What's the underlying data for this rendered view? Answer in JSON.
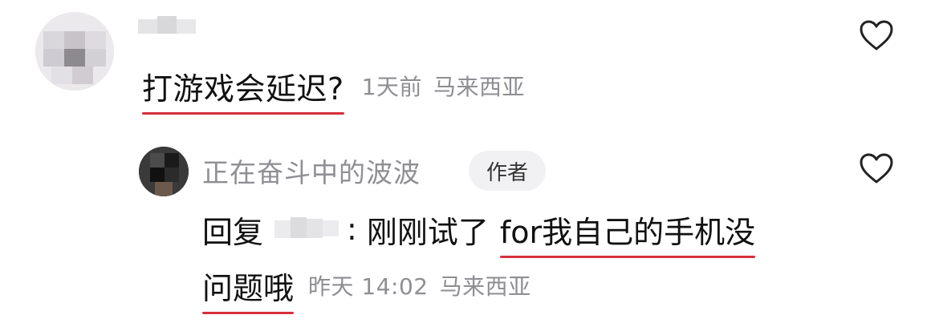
{
  "comment": {
    "text": "打游戏会延迟?",
    "time": "1天前",
    "location": "马来西亚",
    "avatar_icon": "blurred-avatar",
    "like_icon": "heart-outline-icon"
  },
  "reply": {
    "author_name": "正在奋斗中的波波",
    "author_badge": "作者",
    "prefix": "回复",
    "colon": ":",
    "text_plain": "刚刚试了",
    "text_underlined_1": "for我自己的手机没",
    "text_underlined_2": "问题哦",
    "time": "昨天 14:02",
    "location": "马来西亚",
    "avatar_icon": "dark-avatar",
    "like_icon": "heart-outline-icon"
  },
  "colors": {
    "underline": "#d6303b",
    "meta_gray": "#8e8e93",
    "text": "#111111",
    "badge_bg": "#f1f1f3"
  }
}
